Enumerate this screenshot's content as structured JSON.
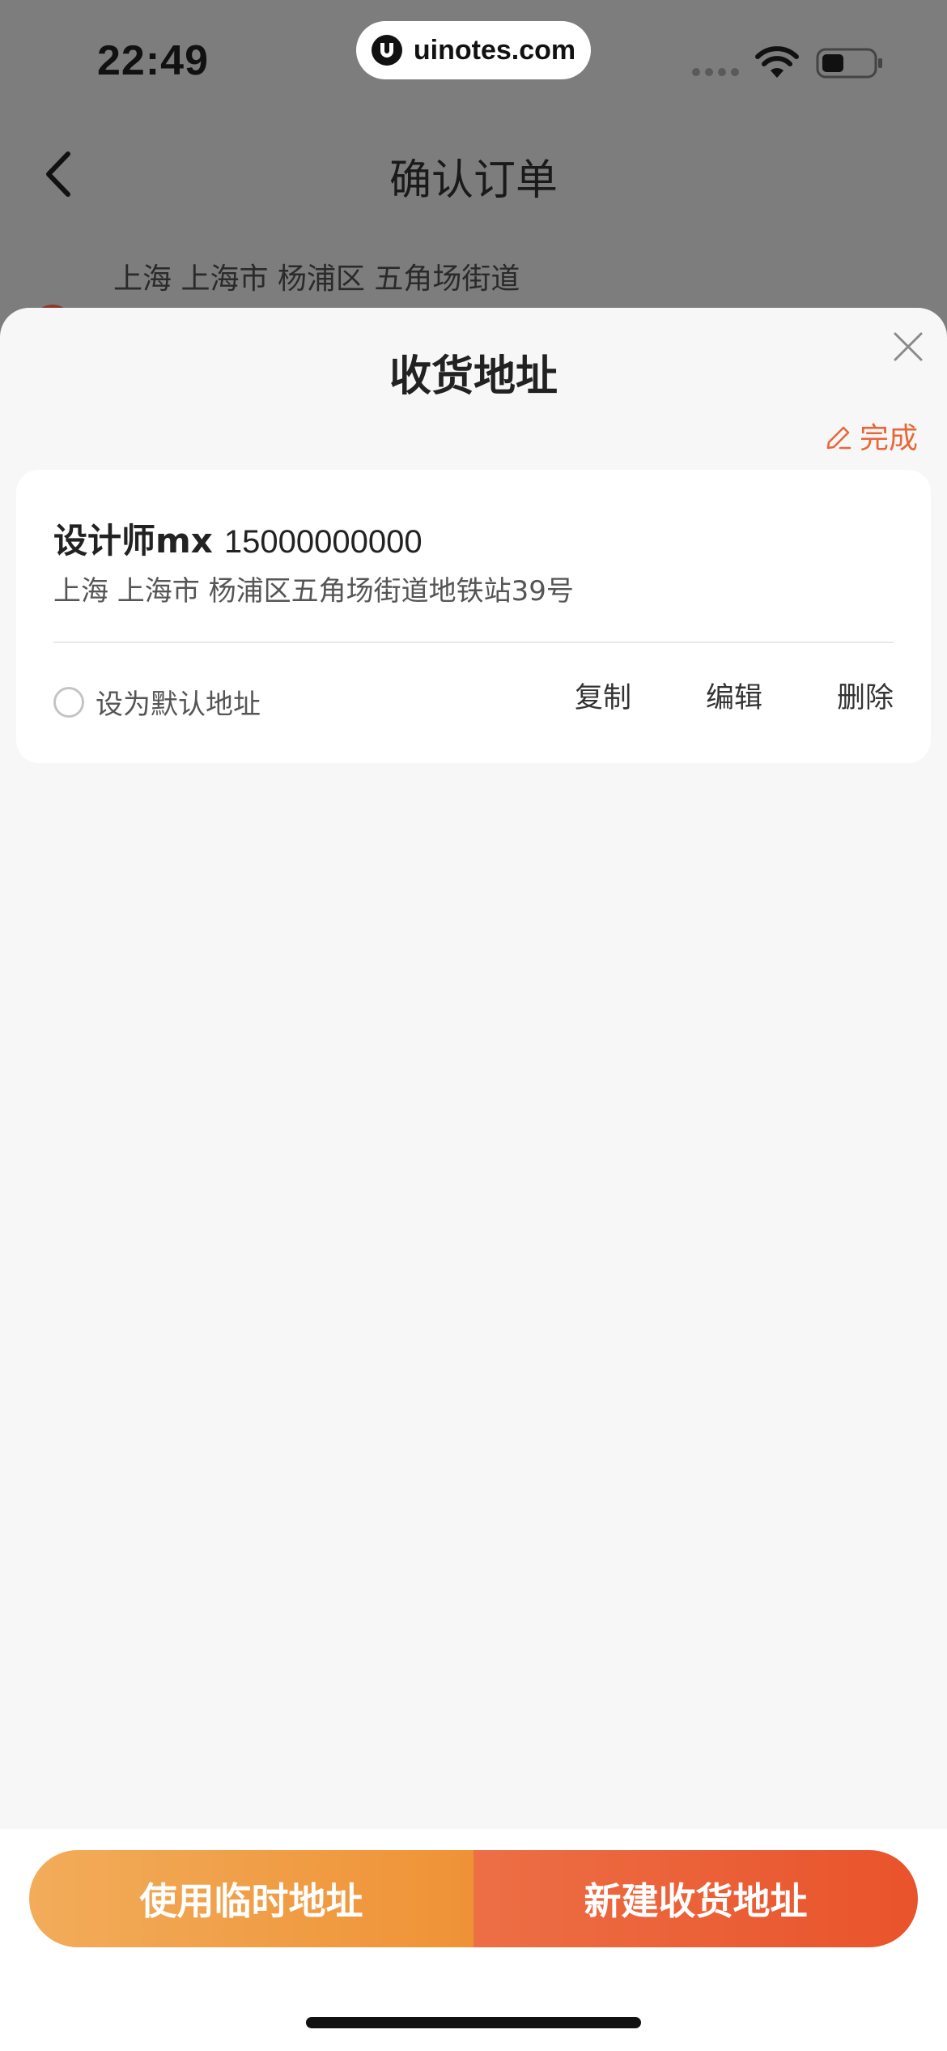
{
  "status_bar": {
    "time": "22:49",
    "url": "uinotes.com"
  },
  "nav": {
    "title": "确认订单"
  },
  "background": {
    "address_preview": "上海 上海市 杨浦区 五角场街道"
  },
  "sheet": {
    "title": "收货地址",
    "done_label": "完成",
    "accent_color": "#e8673a"
  },
  "addresses": [
    {
      "name": "设计师mx",
      "phone": "15000000000",
      "address": "上海 上海市 杨浦区五角场街道地铁站39号",
      "default_label": "设为默认地址",
      "is_default": false,
      "copy_label": "复制",
      "edit_label": "编辑",
      "delete_label": "删除"
    }
  ],
  "bottom": {
    "temp_address_label": "使用临时地址",
    "new_address_label": "新建收货地址"
  }
}
